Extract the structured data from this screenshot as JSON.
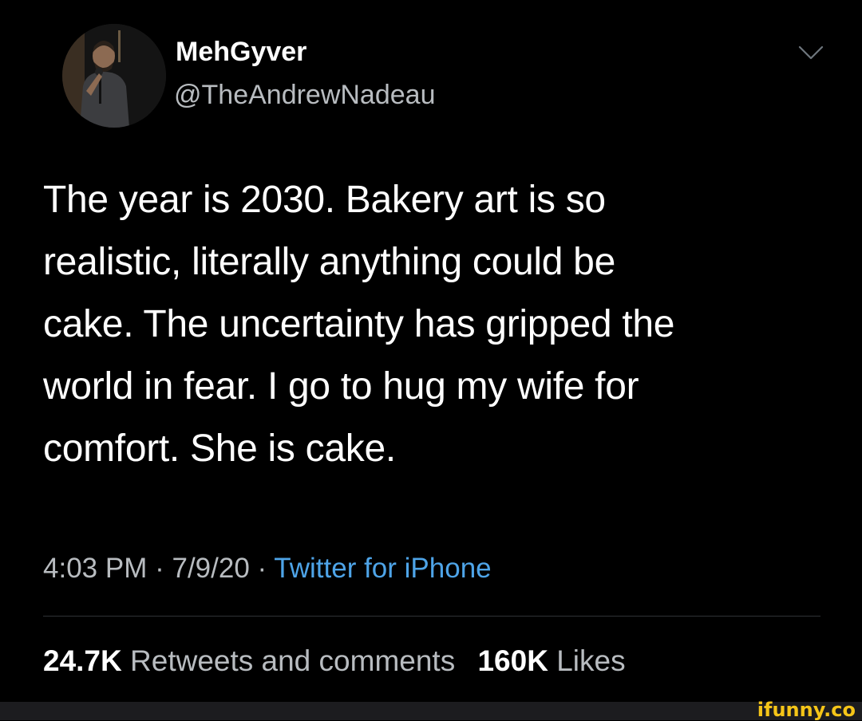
{
  "tweet": {
    "author": {
      "display_name": "MehGyver",
      "handle": "@TheAndrewNadeau"
    },
    "text_lines": [
      "The year is 2030. Bakery art is so",
      "realistic, literally anything could be",
      "cake. The uncertainty has gripped the",
      "world in fear. I go to hug my wife for",
      "comfort. She is cake."
    ],
    "time": "4:03 PM",
    "date": "7/9/20",
    "separator": "·",
    "source": "Twitter for iPhone",
    "stats": {
      "retweets_count": "24.7K",
      "retweets_label": "Retweets and comments",
      "likes_count": "160K",
      "likes_label": "Likes"
    }
  },
  "icons": {
    "menu": "chevron-down-icon",
    "avatar": "avatar"
  },
  "watermark": "ifunny.co",
  "colors": {
    "background": "#000000",
    "text": "#ffffff",
    "secondary_text": "#b8bcc0",
    "link": "#4ea4e8",
    "divider": "#2f3336",
    "watermark": "#f5c518"
  }
}
